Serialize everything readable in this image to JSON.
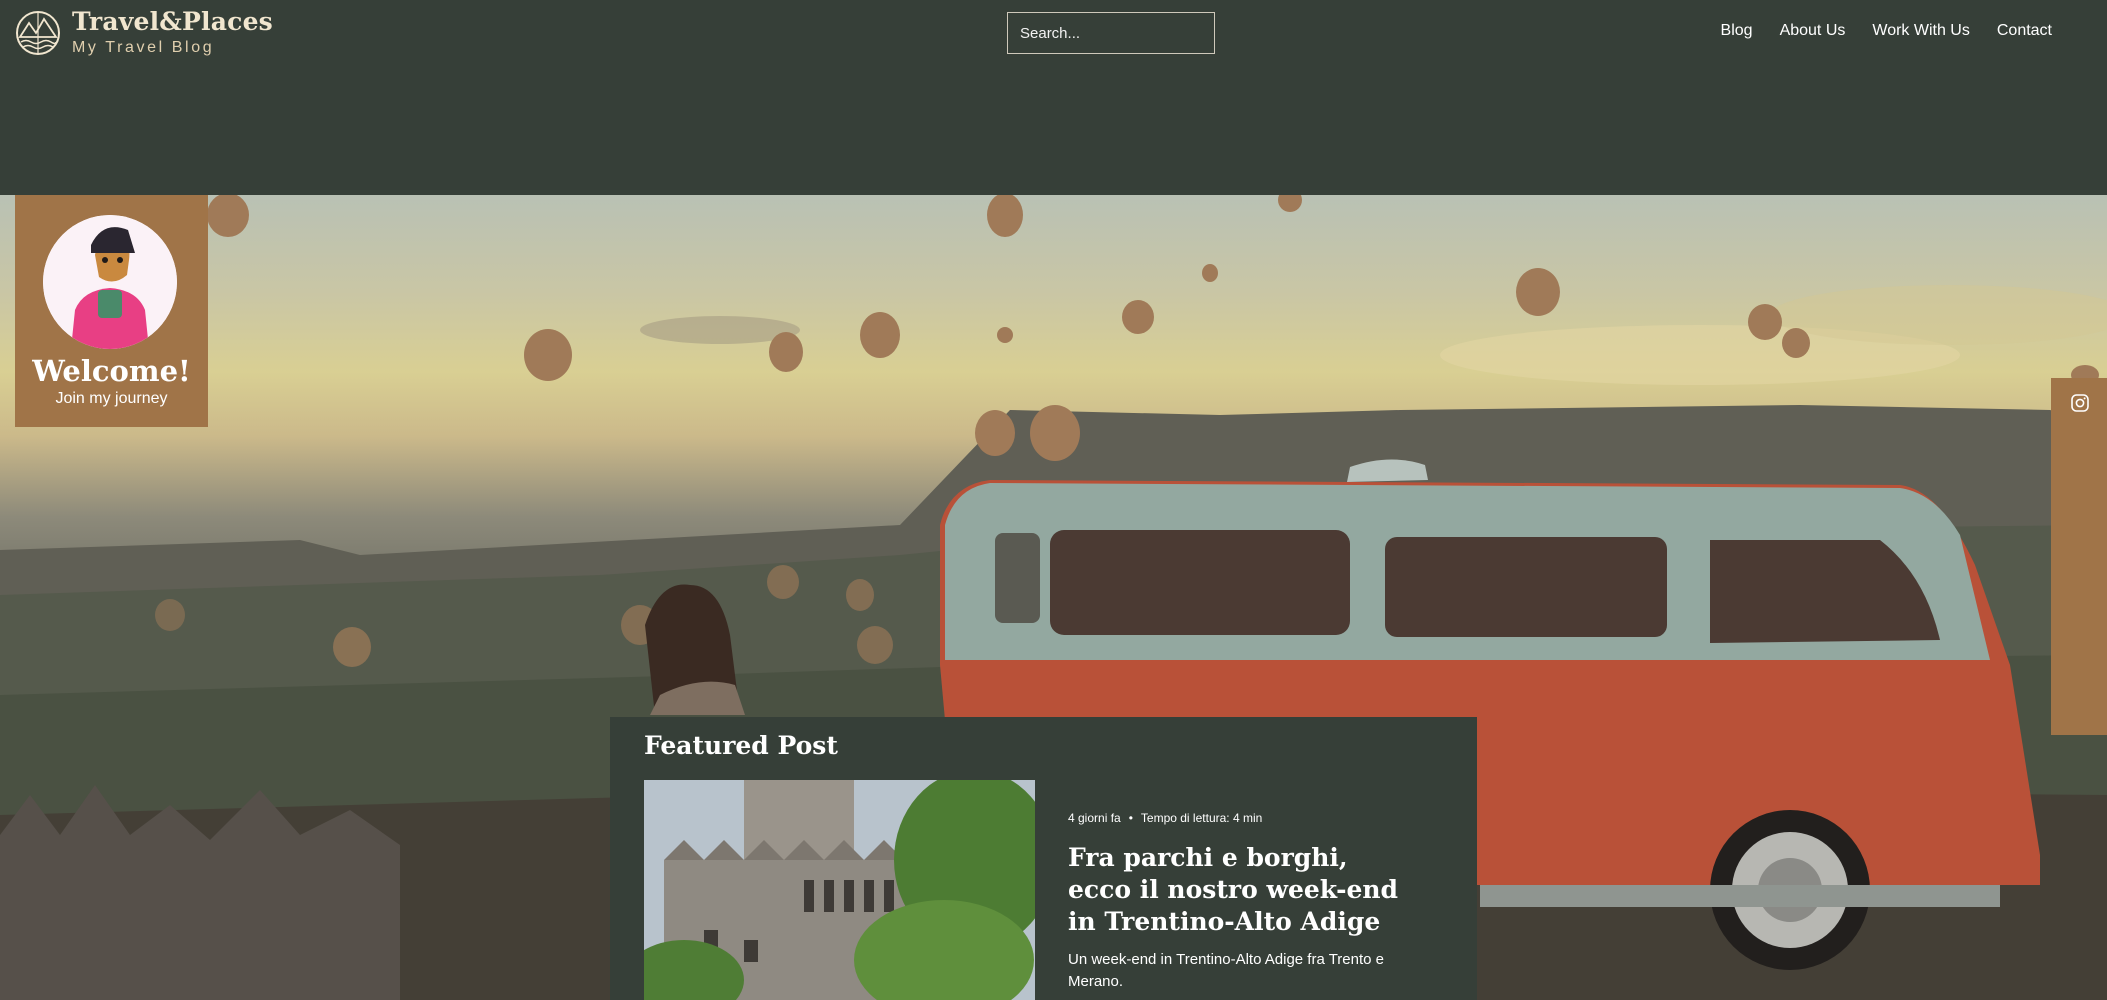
{
  "brand": {
    "title": "Travel&Places",
    "subtitle": "My Travel Blog",
    "colors": {
      "header_bg": "#363f38",
      "accent": "#a07448",
      "logo_text": "#f1e6cf"
    }
  },
  "search": {
    "placeholder": "Search...",
    "icon": "search-icon"
  },
  "nav": {
    "items": [
      {
        "label": "Blog"
      },
      {
        "label": "About Us"
      },
      {
        "label": "Work With Us"
      },
      {
        "label": "Contact"
      }
    ]
  },
  "welcome": {
    "title": "Welcome!",
    "subtitle": "Join my journey"
  },
  "social": {
    "icon": "instagram-icon"
  },
  "featured": {
    "heading": "Featured Post",
    "meta": {
      "age": "4 giorni fa",
      "separator": "•",
      "reading_time": "Tempo di lettura: 4 min"
    },
    "title": "Fra parchi e borghi, ecco il nostro week-end in Trentino-Alto Adige",
    "excerpt": "Un week-end in Trentino-Alto Adige fra Trento e Merano."
  }
}
